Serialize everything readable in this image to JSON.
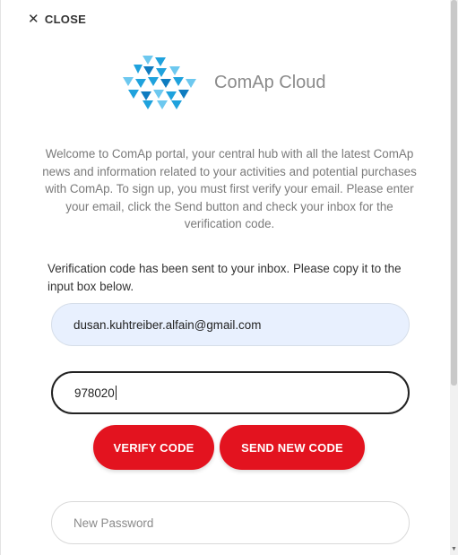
{
  "close": {
    "icon": "close-icon",
    "label": "CLOSE"
  },
  "logo": {
    "icon": "comap-cloud-logo-icon",
    "text": "ComAp Cloud",
    "colors": [
      "#1fa2dd",
      "#0f7cc0",
      "#6dc8ef"
    ]
  },
  "intro_text": "Welcome to ComAp portal, your central hub with all the latest ComAp news and information related to your activities and potential purchases with ComAp. To sign up, you must first verify your email. Please enter your email, click the Send button and check your inbox for the verification code.",
  "notice_text": "Verification code has been sent to your inbox. Please copy it to the input box below.",
  "email_field": {
    "value": "dusan.kuhtreiber.alfain@gmail.com"
  },
  "code_field": {
    "value": "978020"
  },
  "buttons": {
    "verify": "VERIFY CODE",
    "send_new": "SEND NEW CODE",
    "color": "#e3131f"
  },
  "password_field": {
    "placeholder": "New Password"
  }
}
